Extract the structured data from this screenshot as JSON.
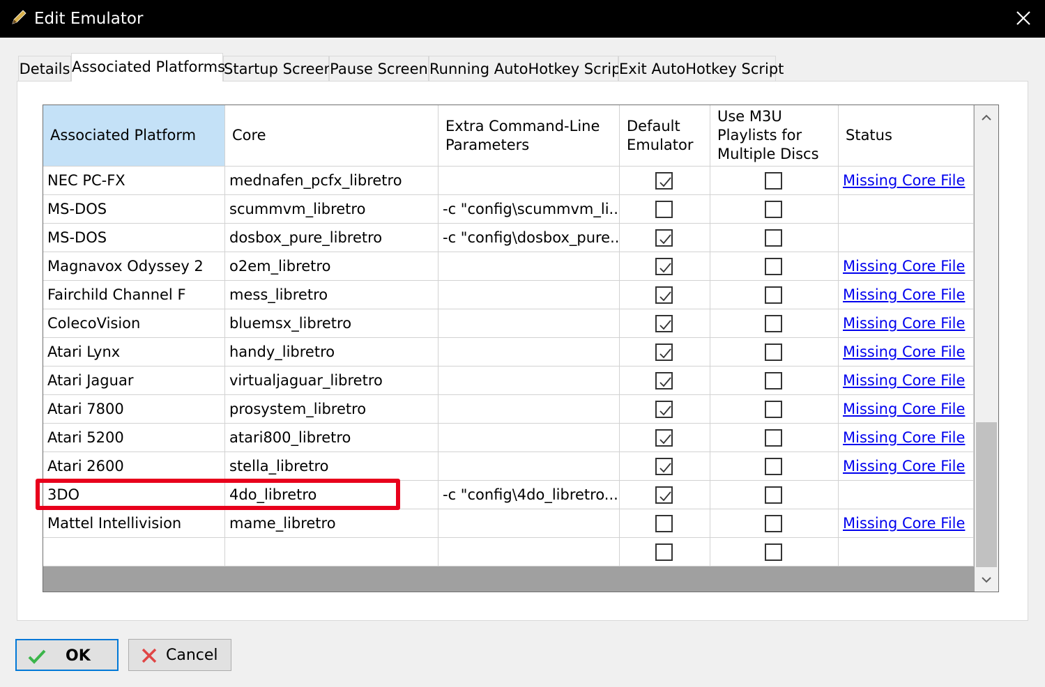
{
  "window": {
    "title": "Edit Emulator",
    "pencil_icon": "pencil-icon",
    "close_icon": "close-icon"
  },
  "tabs": [
    {
      "label": "Details",
      "active": false
    },
    {
      "label": "Associated Platforms",
      "active": true
    },
    {
      "label": "Startup Screen",
      "active": false
    },
    {
      "label": "Pause Screen",
      "active": false
    },
    {
      "label": "Running AutoHotkey Script",
      "active": false
    },
    {
      "label": "Exit AutoHotkey Script",
      "active": false
    }
  ],
  "grid": {
    "headers": {
      "platform": "Associated Platform",
      "core": "Core",
      "params": "Extra Command-Line Parameters",
      "default": "Default Emulator",
      "m3u": "Use M3U Playlists for Multiple Discs",
      "status": "Status"
    },
    "rows": [
      {
        "platform": "NEC PC-FX",
        "core": "mednafen_pcfx_libretro",
        "params": "",
        "default": true,
        "m3u": false,
        "status": "Missing Core File"
      },
      {
        "platform": "MS-DOS",
        "core": "scummvm_libretro",
        "params": "-c \"config\\scummvm_li...",
        "default": false,
        "m3u": false,
        "status": ""
      },
      {
        "platform": "MS-DOS",
        "core": "dosbox_pure_libretro",
        "params": "-c \"config\\dosbox_pure...",
        "default": true,
        "m3u": false,
        "status": ""
      },
      {
        "platform": "Magnavox Odyssey 2",
        "core": "o2em_libretro",
        "params": "",
        "default": true,
        "m3u": false,
        "status": "Missing Core File"
      },
      {
        "platform": "Fairchild Channel F",
        "core": "mess_libretro",
        "params": "",
        "default": true,
        "m3u": false,
        "status": "Missing Core File"
      },
      {
        "platform": "ColecoVision",
        "core": "bluemsx_libretro",
        "params": "",
        "default": true,
        "m3u": false,
        "status": "Missing Core File"
      },
      {
        "platform": "Atari Lynx",
        "core": "handy_libretro",
        "params": "",
        "default": true,
        "m3u": false,
        "status": "Missing Core File"
      },
      {
        "platform": "Atari Jaguar",
        "core": "virtualjaguar_libretro",
        "params": "",
        "default": true,
        "m3u": false,
        "status": "Missing Core File"
      },
      {
        "platform": "Atari 7800",
        "core": "prosystem_libretro",
        "params": "",
        "default": true,
        "m3u": false,
        "status": "Missing Core File"
      },
      {
        "platform": "Atari 5200",
        "core": "atari800_libretro",
        "params": "",
        "default": true,
        "m3u": false,
        "status": "Missing Core File"
      },
      {
        "platform": "Atari 2600",
        "core": "stella_libretro",
        "params": "",
        "default": true,
        "m3u": false,
        "status": "Missing Core File"
      },
      {
        "platform": "3DO",
        "core": "4do_libretro",
        "params": "-c \"config\\4do_libretro....",
        "default": true,
        "m3u": false,
        "status": ""
      },
      {
        "platform": "Mattel Intellivision",
        "core": "mame_libretro",
        "params": "",
        "default": false,
        "m3u": false,
        "status": "Missing Core File"
      },
      {
        "platform": "",
        "core": "",
        "params": "",
        "default": false,
        "m3u": false,
        "status": ""
      }
    ],
    "scroll_icons": {
      "up": "chevron-up-icon",
      "down": "chevron-down-icon"
    }
  },
  "buttons": {
    "ok": {
      "label": "OK",
      "icon": "checkmark-icon"
    },
    "cancel": {
      "label": "Cancel",
      "icon": "x-icon"
    }
  },
  "colors": {
    "title_bar": "#000000",
    "header_selected": "#c4e1f7",
    "link": "#0000ee",
    "highlight_box": "#e8001c",
    "ok_border": "#0078d7"
  }
}
